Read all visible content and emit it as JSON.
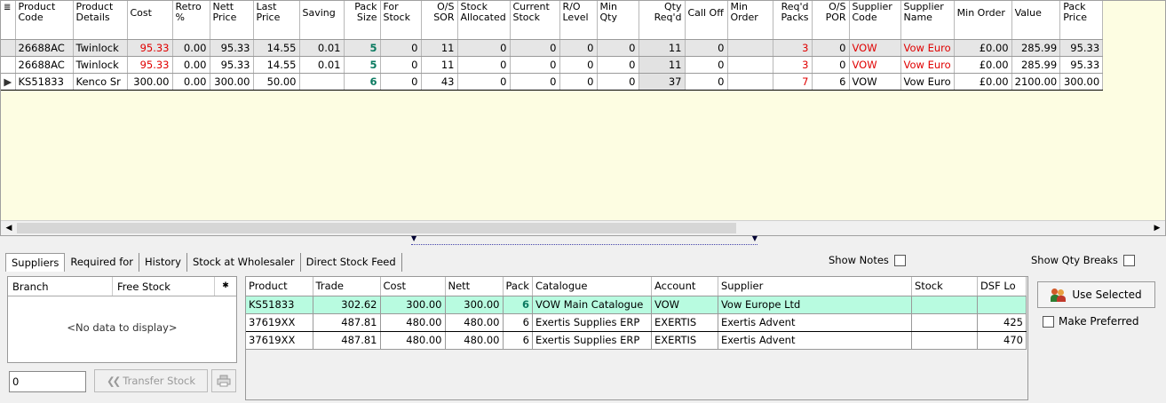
{
  "main_grid": {
    "columns": [
      {
        "label": "Product Code",
        "align": "l"
      },
      {
        "label": "Product Details",
        "align": "l"
      },
      {
        "label": "Cost",
        "align": "l"
      },
      {
        "label": "Retro %",
        "align": "l"
      },
      {
        "label": "Nett Price",
        "align": "l"
      },
      {
        "label": "Last Price",
        "align": "l"
      },
      {
        "label": "Saving",
        "align": "l"
      },
      {
        "label": "Pack Size",
        "align": "r"
      },
      {
        "label": "For Stock",
        "align": "l"
      },
      {
        "label": "O/S SOR",
        "align": "r"
      },
      {
        "label": "Stock Allocated",
        "align": "l"
      },
      {
        "label": "Current Stock",
        "align": "l"
      },
      {
        "label": "R/O Level",
        "align": "l"
      },
      {
        "label": "Min Qty",
        "align": "l"
      },
      {
        "label": "Qty Req'd",
        "align": "r"
      },
      {
        "label": "Call Off",
        "align": "l"
      },
      {
        "label": "Min Order",
        "align": "l"
      },
      {
        "label": "Req'd Packs",
        "align": "r"
      },
      {
        "label": "O/S POR",
        "align": "r"
      },
      {
        "label": "Supplier Code",
        "align": "l"
      },
      {
        "label": "Supplier Name",
        "align": "l"
      },
      {
        "label": "Min Order",
        "align": "l"
      },
      {
        "label": "Value",
        "align": "l"
      },
      {
        "label": "Pack Price",
        "align": "l"
      }
    ],
    "rows": [
      [
        "26688AC",
        "Twinlock",
        "95.33",
        "0.00",
        "95.33",
        "14.55",
        "0.01",
        "5",
        "0",
        "11",
        "0",
        "0",
        "0",
        "0",
        "11",
        "0",
        "",
        "3",
        "0",
        "VOW",
        "Vow Euro",
        "£0.00",
        "285.99",
        "95.33"
      ],
      [
        "26688AC",
        "Twinlock",
        "95.33",
        "0.00",
        "95.33",
        "14.55",
        "0.01",
        "5",
        "0",
        "11",
        "0",
        "0",
        "0",
        "0",
        "11",
        "0",
        "",
        "3",
        "0",
        "VOW",
        "Vow Euro",
        "£0.00",
        "285.99",
        "95.33"
      ],
      [
        "KS51833",
        "Kenco Sr",
        "300.00",
        "0.00",
        "300.00",
        "50.00",
        "",
        "6",
        "0",
        "43",
        "0",
        "0",
        "0",
        "0",
        "37",
        "0",
        "",
        "7",
        "6",
        "VOW",
        "Vow Euro",
        "£0.00",
        "2100.00",
        "300.00"
      ]
    ],
    "row_indicator": "▶",
    "colors": {
      "warning_red": "#e00000",
      "pack_green": "#0a7a60",
      "grid_bg": "#fdfde2"
    }
  },
  "tabs": [
    "Suppliers",
    "Required for",
    "History",
    "Stock at Wholesaler",
    "Direct Stock Feed"
  ],
  "show_notes_label": "Show Notes",
  "show_qty_breaks_label": "Show Qty Breaks",
  "branch_panel": {
    "col_branch": "Branch",
    "col_free_stock": "Free Stock",
    "empty_text": "<No data to display>",
    "qty_value": "0",
    "transfer_label": "Transfer Stock"
  },
  "supplier_grid": {
    "columns": [
      "Product",
      "Trade",
      "Cost",
      "Nett",
      "Pack",
      "Catalogue",
      "Account",
      "Supplier",
      "Stock",
      "DSF Lo"
    ],
    "rows": [
      [
        "KS51833",
        "302.62",
        "300.00",
        "300.00",
        "6",
        "VOW Main Catalogue",
        "VOW",
        "Vow Europe Ltd",
        "",
        ""
      ],
      [
        "37619XX",
        "487.81",
        "480.00",
        "480.00",
        "6",
        "Exertis Supplies ERP",
        "EXERTIS",
        "Exertis Advent",
        "",
        "425"
      ],
      [
        "37619XX",
        "487.81",
        "480.00",
        "480.00",
        "6",
        "Exertis Supplies ERP",
        "EXERTIS",
        "Exertis Advent",
        "",
        "470"
      ]
    ],
    "selected_color": "#b8fbe0"
  },
  "right_panel": {
    "use_selected_label": "Use Selected",
    "make_preferred_label": "Make Preferred"
  }
}
